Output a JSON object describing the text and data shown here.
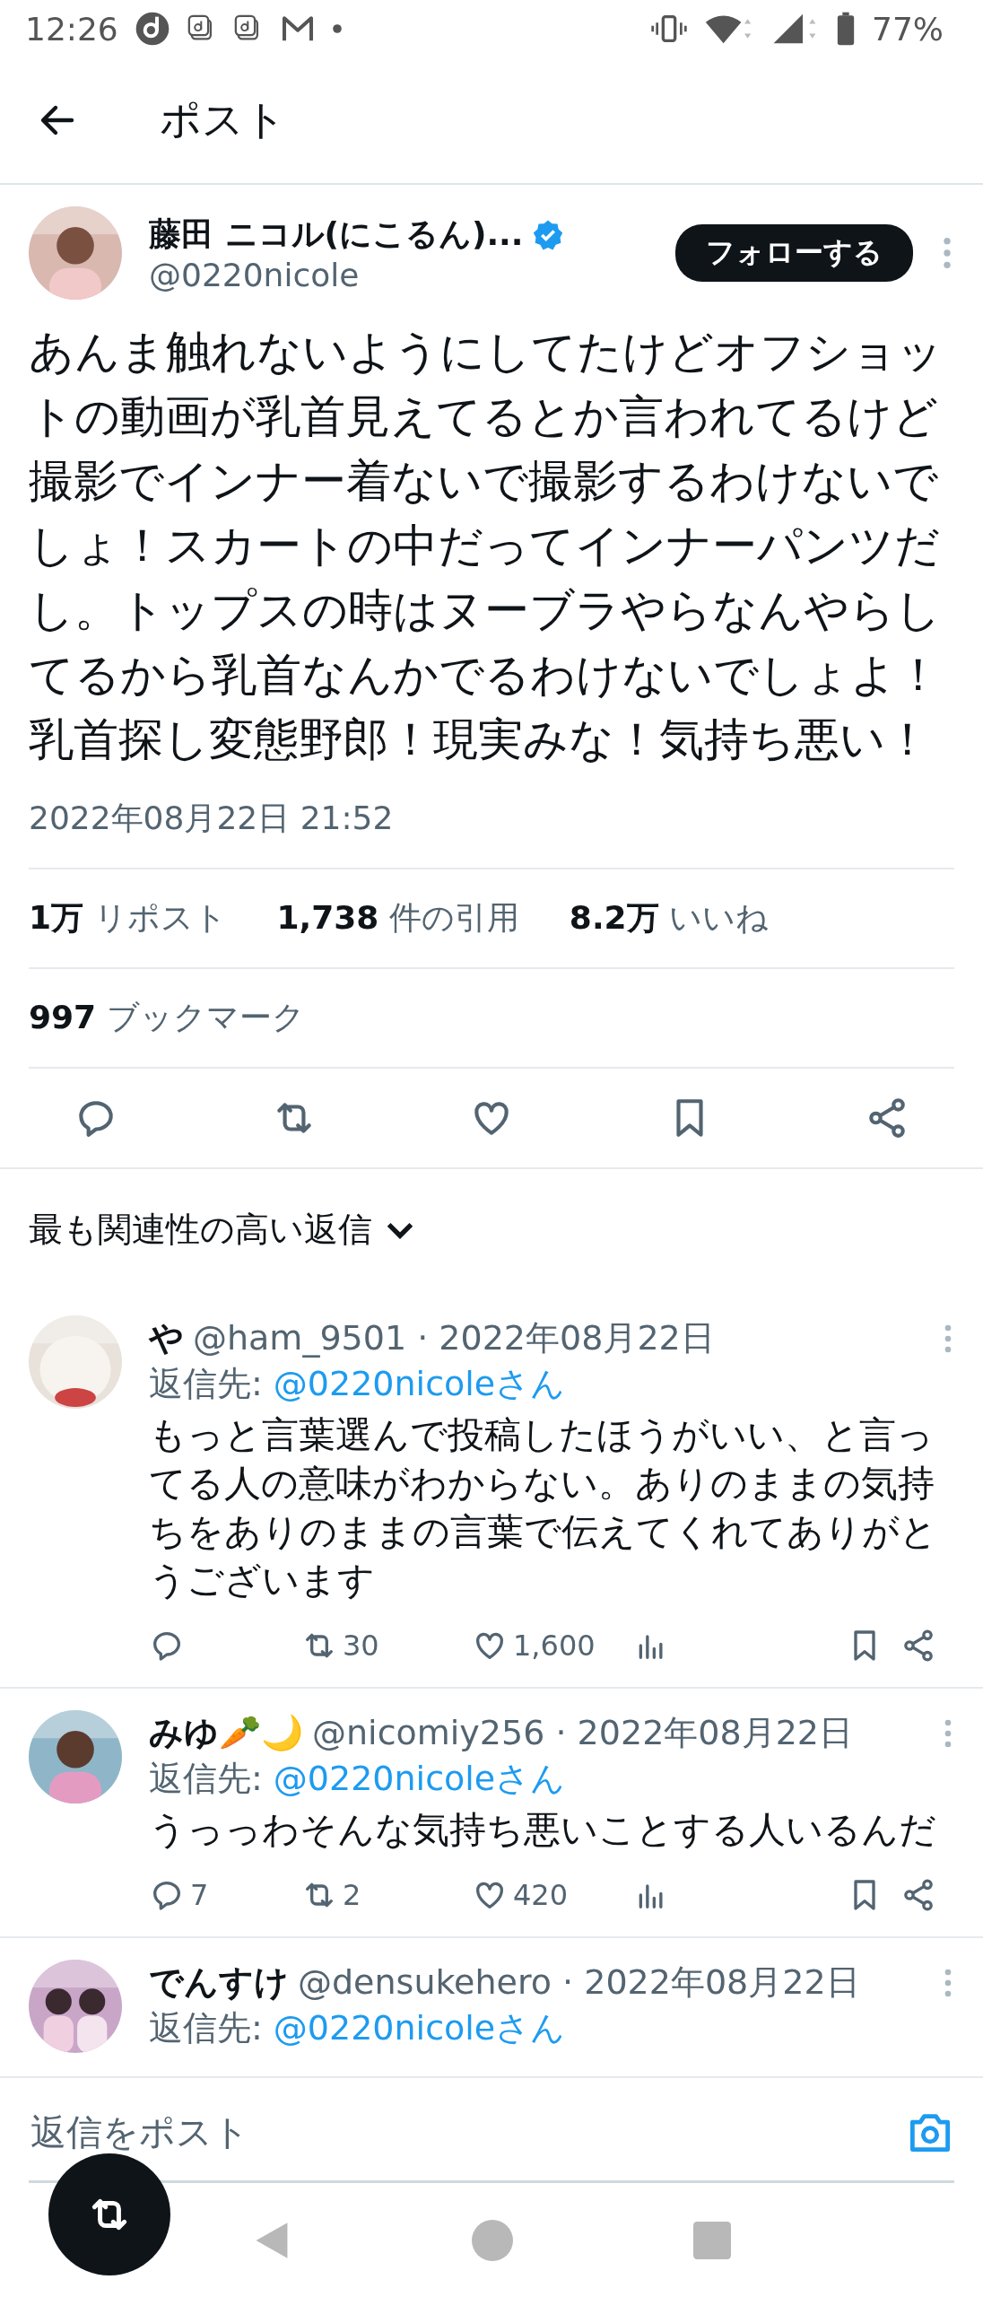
{
  "status_bar": {
    "time": "12:26",
    "battery": "77%"
  },
  "header": {
    "title": "ポスト"
  },
  "post": {
    "author": "藤田 ニコル(にこるん)...",
    "verified": true,
    "handle": "@0220nicole",
    "follow_button": "フォローする",
    "text": "あんま触れないようにしてたけどオフショットの動画が乳首見えてるとか言われてるけど撮影でインナー着ないで撮影するわけないでしょ！スカートの中だってインナーパンツだし。トップスの時はヌーブラやらなんやらしてるから乳首なんかでるわけないでしょよ！乳首探し変態野郎！現実みな！気持ち悪い！",
    "timestamp": "2022年08月22日 21:52",
    "stats": [
      "**1万** リポスト",
      "**1,738** 件の引用",
      "**8.2万** いいね"
    ],
    "bookmarks": "**997** ブックマーク"
  },
  "replies_sort": {
    "label": "最も関連性の高い返信"
  },
  "replies": [
    {
      "name": "や",
      "meta": "@ham_9501 · 2022年08月22日",
      "reply_to_label": "返信先:",
      "reply_to": "@0220nicoleさん",
      "text": "もっと言葉選んで投稿したほうがいい、と言ってる人の意味がわからない。ありのままの気持ちをありのままの言葉で伝えてくれてありがとうございます",
      "reposts": "30",
      "likes": "1,600"
    },
    {
      "name": "みゆ🥕🌙",
      "meta": "@nicomiy256 · 2022年08月22日",
      "reply_to_label": "返信先:",
      "reply_to": "@0220nicoleさん",
      "text": "うっっわそんな気持ち悪いことする人いるんだ",
      "replies": "7",
      "reposts": "2",
      "likes": "420"
    },
    {
      "name": "でんすけ",
      "meta": "@densukehero · 2022年08月22日",
      "reply_to_label": "返信先:",
      "reply_to": "@0220nicoleさん"
    }
  ],
  "composer": {
    "placeholder": "返信をポスト"
  }
}
